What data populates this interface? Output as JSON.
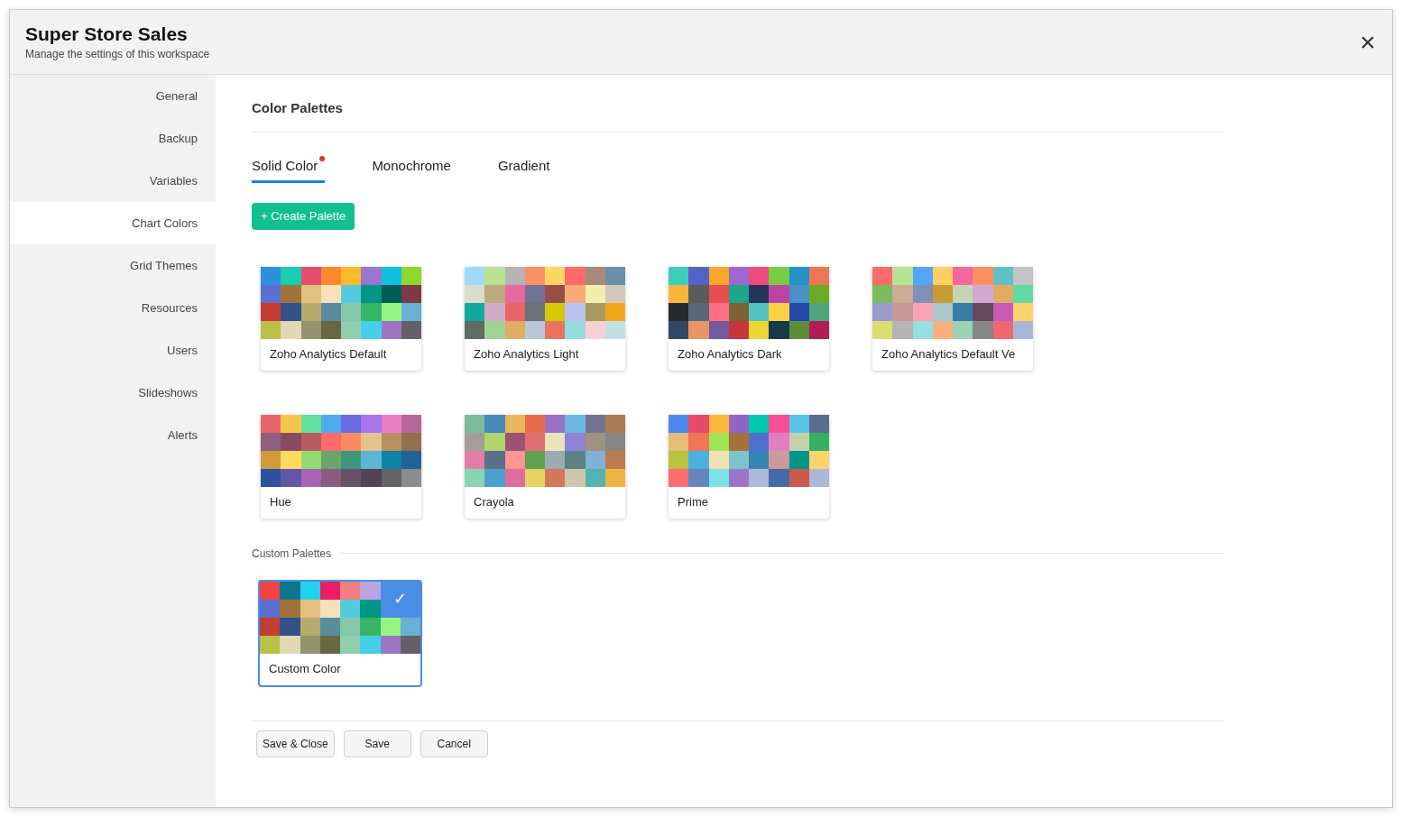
{
  "window": {
    "title": "Super Store Sales",
    "subtitle": "Manage the settings of this workspace",
    "close": "×"
  },
  "sidebar": {
    "items": [
      {
        "label": "General",
        "selected": false
      },
      {
        "label": "Backup",
        "selected": false
      },
      {
        "label": "Variables",
        "selected": false
      },
      {
        "label": "Chart Colors",
        "selected": true
      },
      {
        "label": "Grid Themes",
        "selected": false
      },
      {
        "label": "Resources",
        "selected": false
      },
      {
        "label": "Users",
        "selected": false
      },
      {
        "label": "Slideshows",
        "selected": false
      },
      {
        "label": "Alerts",
        "selected": false
      }
    ]
  },
  "section_title": "Color Palettes",
  "tabs": [
    {
      "label": "Solid Color",
      "selected": true,
      "dot": true
    },
    {
      "label": "Monochrome",
      "selected": false,
      "dot": false
    },
    {
      "label": "Gradient",
      "selected": false,
      "dot": false
    }
  ],
  "create_button": "+ Create Palette",
  "palettes": [
    {
      "name": "Zoho Analytics Default",
      "selected": false,
      "swatches": [
        {
          "color": "#2e8fe0"
        },
        {
          "color": "#18cdb0"
        },
        {
          "color": "#e84c71"
        },
        {
          "color": "#fb8a2e"
        },
        {
          "color": "#fdb92a"
        },
        {
          "color": "#9b75cf"
        },
        {
          "color": "#10c0e0"
        },
        {
          "color": "#91d62c"
        },
        {
          "color": "#5b6fd0"
        },
        {
          "color": "#a0733a"
        },
        {
          "color": "#e2c07e"
        },
        {
          "color": "#f5e2b8"
        },
        {
          "color": "#56cbe0"
        },
        {
          "color": "#009688"
        },
        {
          "color": "#005f55"
        },
        {
          "color": "#7f3b45"
        },
        {
          "color": "#c43d32"
        },
        {
          "color": "#33518a"
        },
        {
          "color": "#b5ad6d"
        },
        {
          "color": "#5a8c9e"
        },
        {
          "color": "#85c9ab"
        },
        {
          "color": "#37b465"
        },
        {
          "color": "#95f581"
        },
        {
          "color": "#6ab0d4"
        },
        {
          "color": "#b9c045"
        },
        {
          "color": "#e4d8b4"
        },
        {
          "color": "#94926f"
        },
        {
          "color": "#696741"
        },
        {
          "color": "#8dcfaf"
        },
        {
          "color": "#44d0e9"
        },
        {
          "color": "#9d74c3"
        },
        {
          "color": "#636167"
        }
      ]
    },
    {
      "name": "Zoho Analytics Light",
      "selected": false,
      "swatches": [
        {
          "color": "#a2d9f8"
        },
        {
          "color": "#b9e393"
        },
        {
          "color": "#b5b5b5"
        },
        {
          "color": "#fd9166"
        },
        {
          "color": "#fed763"
        },
        {
          "color": "#fd6a6a"
        },
        {
          "color": "#a88a7a"
        },
        {
          "color": "#6a8fab"
        },
        {
          "color": "#dcdccb"
        },
        {
          "color": "#bdab7f"
        },
        {
          "color": "#e9679f"
        },
        {
          "color": "#727298"
        },
        {
          "color": "#974e43"
        },
        {
          "color": "#f8ab78"
        },
        {
          "color": "#f2eeb0"
        },
        {
          "color": "#d5c8b8"
        },
        {
          "color": "#15a89d"
        },
        {
          "color": "#d2aacc"
        },
        {
          "color": "#ed6469"
        },
        {
          "color": "#6b7379"
        },
        {
          "color": "#d4c90a"
        },
        {
          "color": "#bbc1ef"
        },
        {
          "color": "#a89b5f"
        },
        {
          "color": "#f0a71b"
        },
        {
          "color": "#5f6b63"
        },
        {
          "color": "#a1d393"
        },
        {
          "color": "#e1ac64"
        },
        {
          "color": "#b8c8d9"
        },
        {
          "color": "#ea735d"
        },
        {
          "color": "#93dde1"
        },
        {
          "color": "#f8cfd6"
        },
        {
          "color": "#c3dfe6"
        }
      ]
    },
    {
      "name": "Zoho Analytics Dark",
      "selected": false,
      "swatches": [
        {
          "color": "#3ecfbc"
        },
        {
          "color": "#5563c6"
        },
        {
          "color": "#fba727"
        },
        {
          "color": "#9e67d3"
        },
        {
          "color": "#ef4b7f"
        },
        {
          "color": "#79cd42"
        },
        {
          "color": "#2491c8"
        },
        {
          "color": "#ef7557"
        },
        {
          "color": "#fbb53d"
        },
        {
          "color": "#5b5b5b"
        },
        {
          "color": "#e84e50"
        },
        {
          "color": "#1da88b"
        },
        {
          "color": "#26345c"
        },
        {
          "color": "#bc44a6"
        },
        {
          "color": "#4890c5"
        },
        {
          "color": "#6daa25"
        },
        {
          "color": "#25282d"
        },
        {
          "color": "#566775"
        },
        {
          "color": "#fe6f84"
        },
        {
          "color": "#7c6133"
        },
        {
          "color": "#52c3bf"
        },
        {
          "color": "#fbd245"
        },
        {
          "color": "#2449ab"
        },
        {
          "color": "#4fa578"
        },
        {
          "color": "#324762"
        },
        {
          "color": "#ea9565"
        },
        {
          "color": "#73599f"
        },
        {
          "color": "#c4373a"
        },
        {
          "color": "#efd534"
        },
        {
          "color": "#163a4c"
        },
        {
          "color": "#5d8c3b"
        },
        {
          "color": "#b11d54"
        }
      ]
    },
    {
      "name": "Zoho Analytics Default Ve",
      "selected": false,
      "swatches": [
        {
          "color": "#fe6b6b"
        },
        {
          "color": "#b6e592"
        },
        {
          "color": "#51a6fa"
        },
        {
          "color": "#fed062"
        },
        {
          "color": "#f866a0"
        },
        {
          "color": "#fe9062"
        },
        {
          "color": "#5fc0c8"
        },
        {
          "color": "#c4c4c4"
        },
        {
          "color": "#78bc5c"
        },
        {
          "color": "#ccaa95"
        },
        {
          "color": "#8090b6"
        },
        {
          "color": "#c89b35"
        },
        {
          "color": "#c5d4b3"
        },
        {
          "color": "#d3a8d2"
        },
        {
          "color": "#e1ab62"
        },
        {
          "color": "#61d9a1"
        },
        {
          "color": "#9b9ccb"
        },
        {
          "color": "#c69898"
        },
        {
          "color": "#faa4b5"
        },
        {
          "color": "#a8c8cb"
        },
        {
          "color": "#367ea6"
        },
        {
          "color": "#684960"
        },
        {
          "color": "#c65bb8"
        },
        {
          "color": "#fed470"
        },
        {
          "color": "#dcdc70"
        },
        {
          "color": "#b4b4b4"
        },
        {
          "color": "#94e0e2"
        },
        {
          "color": "#f9b07e"
        },
        {
          "color": "#9dd1b4"
        },
        {
          "color": "#868686"
        },
        {
          "color": "#ef6570"
        },
        {
          "color": "#a8b8d4"
        }
      ]
    },
    {
      "name": "Hue",
      "selected": false,
      "swatches": [
        {
          "color": "#ea6668"
        },
        {
          "color": "#f3c84a"
        },
        {
          "color": "#66de9d"
        },
        {
          "color": "#51aaee"
        },
        {
          "color": "#6b6de4"
        },
        {
          "color": "#a875ea"
        },
        {
          "color": "#ea7fc4"
        },
        {
          "color": "#b9659b"
        },
        {
          "color": "#8d607c"
        },
        {
          "color": "#8a4a61"
        },
        {
          "color": "#b75c5c"
        },
        {
          "color": "#fe6b6b"
        },
        {
          "color": "#fe8a64"
        },
        {
          "color": "#e5c38c"
        },
        {
          "color": "#b99160"
        },
        {
          "color": "#917050"
        },
        {
          "color": "#d19a3a"
        },
        {
          "color": "#fcdc5e"
        },
        {
          "color": "#92d974"
        },
        {
          "color": "#68a66b"
        },
        {
          "color": "#3d967a"
        },
        {
          "color": "#5eb4d3"
        },
        {
          "color": "#0e82a4"
        },
        {
          "color": "#226295"
        },
        {
          "color": "#2b53a0"
        },
        {
          "color": "#6555a5"
        },
        {
          "color": "#a963b2"
        },
        {
          "color": "#8a5c80"
        },
        {
          "color": "#675168"
        },
        {
          "color": "#544257"
        },
        {
          "color": "#646464"
        },
        {
          "color": "#8c8c8c"
        }
      ]
    },
    {
      "name": "Crayola",
      "selected": false,
      "swatches": [
        {
          "color": "#7bbd98"
        },
        {
          "color": "#478bbb"
        },
        {
          "color": "#e8b75e"
        },
        {
          "color": "#e66c4f"
        },
        {
          "color": "#9b70c2"
        },
        {
          "color": "#6cb8e2"
        },
        {
          "color": "#737493"
        },
        {
          "color": "#a97a52"
        },
        {
          "color": "#a39f98"
        },
        {
          "color": "#b2d46c"
        },
        {
          "color": "#9c5273"
        },
        {
          "color": "#e07070"
        },
        {
          "color": "#ebe3bb"
        },
        {
          "color": "#9183d3"
        },
        {
          "color": "#9d9380"
        },
        {
          "color": "#858585"
        },
        {
          "color": "#e07fa5"
        },
        {
          "color": "#5b6e8a"
        },
        {
          "color": "#fd9690"
        },
        {
          "color": "#5da152"
        },
        {
          "color": "#9aacb1"
        },
        {
          "color": "#5a8384"
        },
        {
          "color": "#82b1d6"
        },
        {
          "color": "#bd7a53"
        },
        {
          "color": "#8ad4b3"
        },
        {
          "color": "#4aa1c9"
        },
        {
          "color": "#de6d9d"
        },
        {
          "color": "#e4d362"
        },
        {
          "color": "#d7745e"
        },
        {
          "color": "#cdc7ab"
        },
        {
          "color": "#54b3b3"
        },
        {
          "color": "#eeb442"
        }
      ]
    },
    {
      "name": "Prime",
      "selected": false,
      "swatches": [
        {
          "color": "#4e88ef"
        },
        {
          "color": "#e84b69"
        },
        {
          "color": "#fcb73b"
        },
        {
          "color": "#9364c8"
        },
        {
          "color": "#00c8b1"
        },
        {
          "color": "#fa4e97"
        },
        {
          "color": "#58c7e6"
        },
        {
          "color": "#5c6c8c"
        },
        {
          "color": "#e4bd79"
        },
        {
          "color": "#ef7554"
        },
        {
          "color": "#9ee453"
        },
        {
          "color": "#a4733c"
        },
        {
          "color": "#536fcc"
        },
        {
          "color": "#e17ec2"
        },
        {
          "color": "#c5d1ab"
        },
        {
          "color": "#33b062"
        },
        {
          "color": "#b9c13e"
        },
        {
          "color": "#4bb2e0"
        },
        {
          "color": "#f2e2b3"
        },
        {
          "color": "#7cc4cc"
        },
        {
          "color": "#3582b5"
        },
        {
          "color": "#cd9a9a"
        },
        {
          "color": "#00958a"
        },
        {
          "color": "#fdd46a"
        },
        {
          "color": "#fc6e6d"
        },
        {
          "color": "#6585bb"
        },
        {
          "color": "#7be3e4"
        },
        {
          "color": "#9c76c5"
        },
        {
          "color": "#aab9d9"
        },
        {
          "color": "#4669a9"
        },
        {
          "color": "#cc5a4a"
        },
        {
          "color": "#aab8d8"
        }
      ]
    }
  ],
  "custom_section": "Custom Palettes",
  "custom_palettes": [
    {
      "name": "Custom Color",
      "selected": true,
      "check": "✓",
      "swatches": [
        {
          "color": "#ef4444"
        },
        {
          "color": "#0e7490"
        },
        {
          "color": "#22d3ee"
        },
        {
          "color": "#e91e63"
        },
        {
          "color": "#f28080"
        },
        {
          "color": "#b8a4e0"
        },
        {
          "color": "#5b6fd0"
        },
        {
          "color": "#a0733a"
        },
        {
          "color": "#e2c07e"
        },
        {
          "color": "#f5e2b8"
        },
        {
          "color": "#56cbe0"
        },
        {
          "color": "#009688"
        },
        {
          "color": "#c43d32"
        },
        {
          "color": "#33518a"
        },
        {
          "color": "#b5ad6d"
        },
        {
          "color": "#5a8c9e"
        },
        {
          "color": "#85c9ab"
        },
        {
          "color": "#37b465"
        },
        {
          "color": "#95f581"
        },
        {
          "color": "#6ab0d4"
        },
        {
          "color": "#b9c045"
        },
        {
          "color": "#e4d8b4"
        },
        {
          "color": "#94926f"
        },
        {
          "color": "#696741"
        },
        {
          "color": "#8dcfaf"
        },
        {
          "color": "#44d0e9"
        },
        {
          "color": "#9d74c3"
        },
        {
          "color": "#636167"
        }
      ]
    }
  ],
  "buttons": [
    "Save & Close",
    "Save",
    "Cancel"
  ]
}
